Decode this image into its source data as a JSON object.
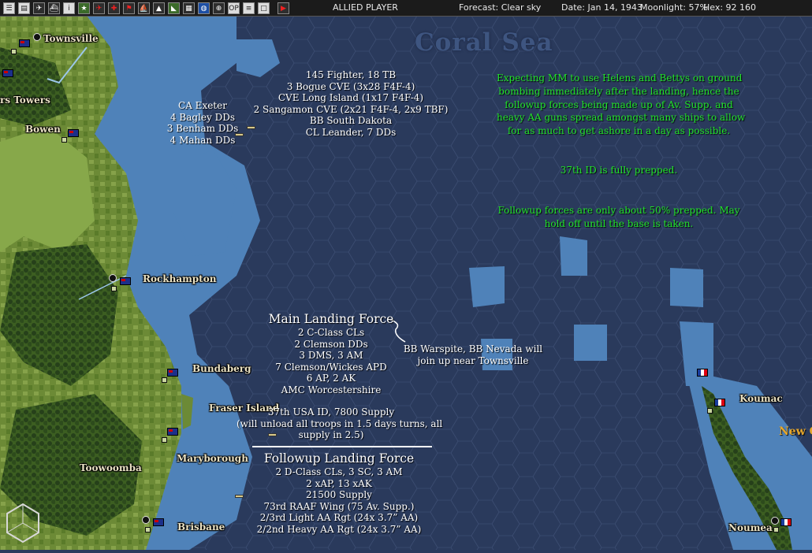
{
  "toolbar": {
    "side": "ALLIED PLAYER",
    "forecast": "Forecast: Clear sky",
    "date": "Date: Jan 14, 1943",
    "moonlight": "Moonlight: 57%",
    "hex": "Hex: 92 160",
    "buttons": [
      {
        "name": "menu-icon",
        "glyph": "☰",
        "style": "light"
      },
      {
        "name": "report-icon",
        "glyph": "▤",
        "style": "light"
      },
      {
        "name": "aircraft-icon",
        "glyph": "✈",
        "style": ""
      },
      {
        "name": "ship-icon",
        "glyph": "⛴",
        "style": ""
      },
      {
        "name": "info-icon",
        "glyph": "i",
        "style": "light"
      },
      {
        "name": "star-icon",
        "glyph": "★",
        "style": "green"
      },
      {
        "name": "plane-red-icon",
        "glyph": "✈",
        "style": "red"
      },
      {
        "name": "medic-icon",
        "glyph": "✚",
        "style": "red"
      },
      {
        "name": "flag-icon",
        "glyph": "⚑",
        "style": "red"
      },
      {
        "name": "sub-icon",
        "glyph": "⛵",
        "style": ""
      },
      {
        "name": "ground-icon",
        "glyph": "▲",
        "style": ""
      },
      {
        "name": "terrain-icon",
        "glyph": "◣",
        "style": "green"
      },
      {
        "name": "base-icon",
        "glyph": "▦",
        "style": ""
      },
      {
        "name": "globe-icon",
        "glyph": "◍",
        "style": "blue"
      },
      {
        "name": "zoom-icon",
        "glyph": "⊕",
        "style": ""
      },
      {
        "name": "op-icon",
        "glyph": "OP",
        "style": "light"
      },
      {
        "name": "list-icon",
        "glyph": "≡",
        "style": "light"
      },
      {
        "name": "window-icon",
        "glyph": "□",
        "style": "light"
      },
      {
        "name": "end-turn-icon",
        "glyph": "▶",
        "style": "red"
      }
    ]
  },
  "map": {
    "sea_label": "Coral Sea",
    "region_label": "New C",
    "towns": [
      {
        "name": "Townsville"
      },
      {
        "name": "rs Towers"
      },
      {
        "name": "Bowen"
      },
      {
        "name": "Rockhampton"
      },
      {
        "name": "Bundaberg"
      },
      {
        "name": "Fraser Island"
      },
      {
        "name": "Maryborough"
      },
      {
        "name": "Toowoomba"
      },
      {
        "name": "Brisbane"
      },
      {
        "name": "Koumac"
      },
      {
        "name": "Noumea"
      }
    ],
    "colors": {
      "land": "#5d7f2f",
      "forest": "#2f4f1c",
      "shallow": "#5b8dc2",
      "deep": "#2a3a5c",
      "green_text": "#22e22a"
    }
  },
  "annotations": {
    "cv_group": [
      "145 Fighter, 18 TB",
      "3 Bogue CVE (3x28 F4F-4)",
      "CVE Long Island (1x17 F4F-4)",
      "2 Sangamon CVE (2x21 F4F-4, 2x9 TBF)",
      "BB South Dakota",
      "CL Leander, 7 DDs"
    ],
    "cruiser_group": [
      "CA Exeter",
      "4 Bagley DDs",
      "3 Benham DDs",
      "4 Mahan DDs"
    ],
    "main_landing": {
      "title": "Main Landing Force",
      "lines": [
        "2 C-Class CLs",
        "2 Clemson DDs",
        "3 DMS, 3 AM",
        "7 Clemson/Wickes APD",
        "6 AP, 2 AK",
        "AMC Worcestershire"
      ],
      "troops": [
        "37th USA ID, 7800 Supply",
        "(will unload all troops in 1.5 days turns, all",
        "supply in 2.5)"
      ]
    },
    "warspite_note": [
      "BB Warspite, BB Nevada will",
      "join up near Townsville"
    ],
    "followup_landing": {
      "title": "Followup Landing Force",
      "lines": [
        "2 D-Class CLs, 3 SC, 3 AM",
        "2 xAP, 13 xAK",
        "21500 Supply",
        "73rd RAAF Wing (75 Av. Supp.)",
        "2/3rd Light AA Rgt (24x 3.7” AA)",
        "2/2nd Heavy AA Rgt (24x 3.7” AA)"
      ]
    },
    "green_notes": {
      "block1": [
        "Expecting MM to use Helens and Bettys on ground",
        "bombing immediately after the landing, hence the",
        "followup forces being made up of Av. Supp. and",
        "heavy AA guns spread amongst many ships to allow",
        "for as much to get ashore in a day as possible."
      ],
      "block2": [
        "37th ID is fully prepped."
      ],
      "block3": [
        "Followup forces are only about 50% prepped. May",
        "hold off until the base is taken."
      ]
    }
  }
}
